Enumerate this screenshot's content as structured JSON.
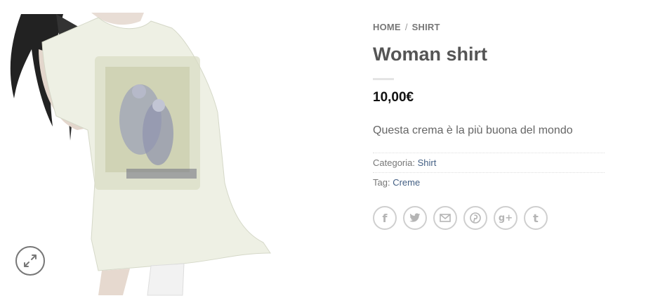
{
  "breadcrumb": {
    "home": "HOME",
    "separator": "/",
    "current": "SHIRT"
  },
  "product": {
    "title": "Woman shirt",
    "price": "10,00€",
    "description": "Questa crema è la più buona del mondo"
  },
  "meta": {
    "category_label": "Categoria:",
    "category_value": "Shirt",
    "tag_label": "Tag:",
    "tag_value": "Creme"
  },
  "share": {
    "facebook": "f",
    "twitter": "twitter-icon",
    "email": "email-icon",
    "pinterest": "pinterest-icon",
    "googleplus": "g+",
    "tumblr": "t"
  },
  "colors": {
    "link": "#446084",
    "icon": "#b5b5b5",
    "shirt": "#eef0e4"
  }
}
